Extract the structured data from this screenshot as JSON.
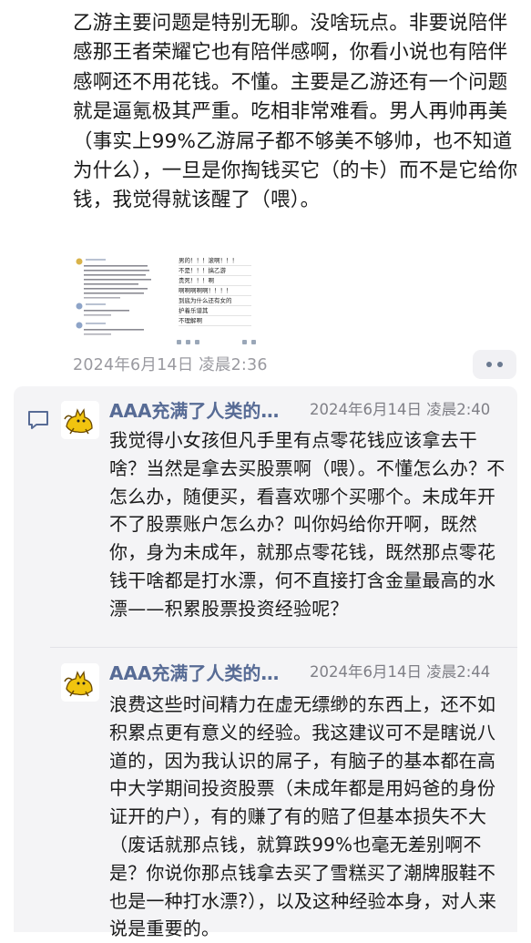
{
  "post": {
    "body": "乙游主要问题是特别无聊。没啥玩点。非要说陪伴感那王者荣耀它也有陪伴感啊，你看小说也有陪伴感啊还不用花钱。不懂。主要是乙游还有一个问题就是逼氪极其严重。吃相非常难看。男人再帅再美（事实上99%乙游屌子都不够美不够帅，也不知道为什么），一旦是你掏钱买它（的卡）而不是它给你钱，我觉得就该醒了（喂）。",
    "timestamp": "2024年6月14日 凌晨2:36",
    "images": [
      {
        "icon": "screenshot-thumbnail-comment-list"
      },
      {
        "icon": "screenshot-thumbnail-chat",
        "lines": [
          "男的！！！滚啊！！！",
          "不是！！！搞乙游",
          "贵死！！！啊",
          "啊啊啊啊啊！！！！",
          "到底为什么还有女的",
          "护着乐谱其",
          "不理解啊"
        ]
      }
    ],
    "more_icon": "ellipsis-icon"
  },
  "comments": [
    {
      "author": "AAA充满了人类的…",
      "timestamp": "2024年6月14日 凌晨2:40",
      "body": "我觉得小女孩但凡手里有点零花钱应该拿去干啥？当然是拿去买股票啊（喂）。不懂怎么办？不怎么办，随便买，看喜欢哪个买哪个。未成年开不了股票账户怎么办？叫你妈给你开啊，既然你，身为未成年，就那点零花钱，既然那点零花钱干啥都是打水漂，何不直接打含金量最高的水漂——积累股票投资经验呢？",
      "avatar_icon": "yellow-cat-avatar"
    },
    {
      "author": "AAA充满了人类的…",
      "timestamp": "2024年6月14日 凌晨2:44",
      "body": "浪费这些时间精力在虚无缥缈的东西上，还不如积累点更有意义的经验。我这建议可不是瞎说八道的，因为我认识的屌子，有脑子的基本都在高中大学期间投资股票（未成年都是用妈爸的身份证开的户），有的赚了有的赔了但基本损失不大（废话就那点钱，就算跌99%也毫无差别啊不是？你说你那点钱拿去买了雪糕买了潮牌服鞋不也是一种打水漂?），以及这种经验本身，对人来说是重要的。",
      "avatar_icon": "yellow-cat-avatar"
    }
  ],
  "comment_icon": "comment-bubble-icon",
  "colors": {
    "author": "#576b95",
    "timestamp": "#9a9aa0",
    "panel_bg": "#f4f4f6"
  }
}
